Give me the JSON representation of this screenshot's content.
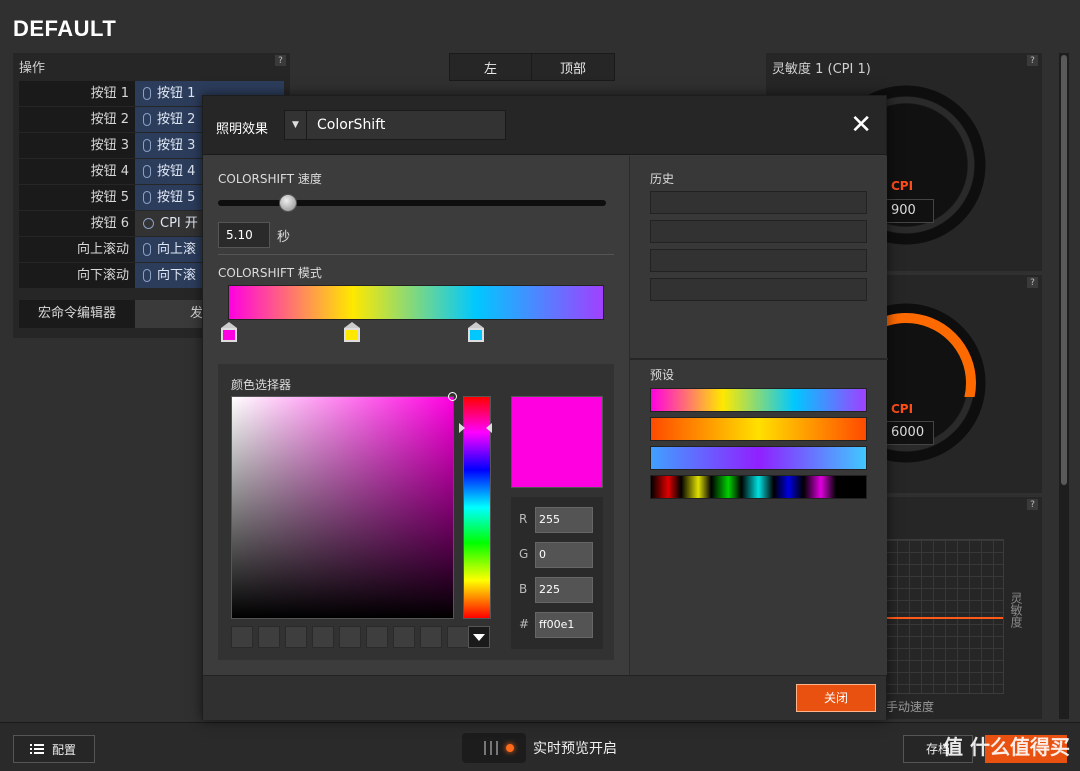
{
  "app": {
    "title": "DEFAULT"
  },
  "side_tabs": [
    "左",
    "顶部"
  ],
  "left_panel": {
    "title": "操作",
    "help": "?",
    "rows": [
      {
        "key": "按钮 1",
        "value": "按钮 1"
      },
      {
        "key": "按钮 2",
        "value": "按钮 2"
      },
      {
        "key": "按钮 3",
        "value": "按钮 3"
      },
      {
        "key": "按钮 4",
        "value": "按钮 4"
      },
      {
        "key": "按钮 5",
        "value": "按钮 5"
      },
      {
        "key": "按钮 6",
        "value": "CPI 开"
      },
      {
        "key": "向上滚动",
        "value": "向上滚"
      },
      {
        "key": "向下滚动",
        "value": "向下滚"
      }
    ],
    "macro": {
      "key": "宏命令编辑器",
      "value": "发"
    }
  },
  "right_panels": {
    "sensitivity_title": "灵敏度 1 (CPI 1)",
    "help": "?",
    "gauge1": {
      "label": "CPI",
      "value": "900"
    },
    "gauge2": {
      "label": "CPI",
      "value": "6000"
    },
    "graph": {
      "vlabel": "灵敏度",
      "hlabel": "手动速度"
    }
  },
  "bottom_bar": {
    "config_label": "配置",
    "preview_label": "实时预览开启",
    "save_label": "存档",
    "apply_label": "",
    "watermark": "值 什么值得买"
  },
  "modal": {
    "effect_label": "照明效果",
    "effect_value": "ColorShift",
    "close_icon": "✕",
    "speed_label": "COLORSHIFT 速度",
    "speed_value": "5.10",
    "speed_unit": "秒",
    "mode_label": "COLORSHIFT 模式",
    "gradient_stops": [
      "#ff00e1",
      "#ffe800",
      "#00c8ff"
    ],
    "picker_label": "颜色选择器",
    "color": {
      "r": "255",
      "g": "0",
      "b": "225",
      "hex": "ff00e1",
      "r_label": "R",
      "g_label": "G",
      "b_label": "B",
      "hex_label": "#"
    },
    "history_label": "历史",
    "preset_label": "预设",
    "close_button": "关闭"
  },
  "colors": {
    "accent": "#e8510f",
    "selected_color": "#ff00e1"
  }
}
